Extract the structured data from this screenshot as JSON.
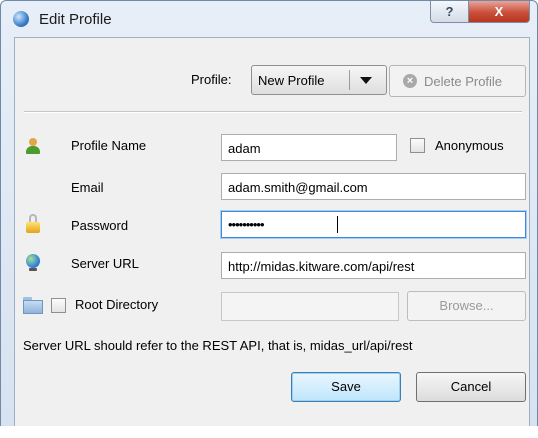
{
  "window": {
    "title": "Edit Profile",
    "help_glyph": "?",
    "close_glyph": "X"
  },
  "profile": {
    "label": "Profile:",
    "selected": "New Profile",
    "delete_label": "Delete Profile"
  },
  "form": {
    "profile_name": {
      "label": "Profile Name",
      "value": "adam"
    },
    "anonymous": {
      "label": "Anonymous",
      "checked": false
    },
    "email": {
      "label": "Email",
      "value": "adam.smith@gmail.com"
    },
    "password": {
      "label": "Password",
      "value": "••••••••••"
    },
    "server_url": {
      "label": "Server URL",
      "value": "http://midas.kitware.com/api/rest"
    },
    "root_directory": {
      "label": "Root Directory",
      "checked": false,
      "value": ""
    },
    "browse_label": "Browse...",
    "hint": "Server URL should refer to the REST API, that is, midas_url/api/rest"
  },
  "buttons": {
    "save": "Save",
    "cancel": "Cancel"
  },
  "icons": {
    "app": "app-icon",
    "profile_name": "user-icon",
    "password": "lock-icon",
    "server_url": "globe-icon",
    "root_directory": "folder-icon",
    "delete": "delete-icon"
  }
}
